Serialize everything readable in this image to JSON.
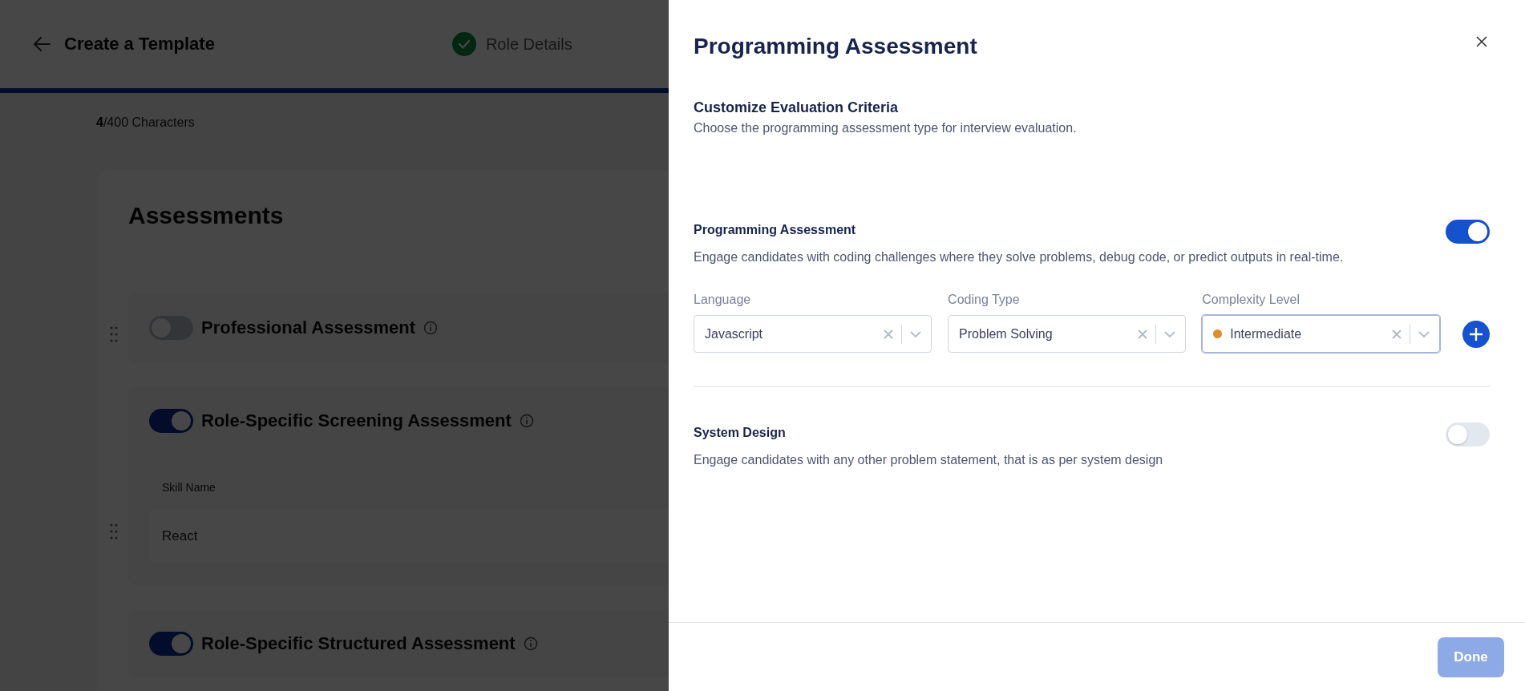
{
  "header": {
    "title": "Create a Template",
    "steps": [
      {
        "label": "Role Details",
        "completed": true
      }
    ]
  },
  "character_count": "**4**/400 Characters",
  "assessments": {
    "title": "Assessments",
    "items": [
      {
        "name": "Professional Assessment",
        "on": false,
        "draggable": true
      },
      {
        "name": "Role-Specific Screening Assessment",
        "on": true,
        "draggable": false,
        "field_draggable": true,
        "field_label": "Skill Name",
        "field_value": "React"
      },
      {
        "name": "Role-Specific Structured Assessment",
        "on": true,
        "draggable": false
      }
    ]
  },
  "drawer": {
    "title": "Programming Assessment",
    "section_title": "Customize Evaluation Criteria",
    "section_subtitle": "Choose the programming assessment type for interview evaluation.",
    "options": [
      {
        "title": "Programming Assessment",
        "description": "Engage candidates with coding challenges where they solve problems, debug code, or predict outputs in real-time.",
        "on": true,
        "fields": [
          {
            "label": "Language",
            "value": "Javascript",
            "focused": false
          },
          {
            "label": "Coding Type",
            "value": "Problem Solving",
            "focused": false
          },
          {
            "label": "Complexity Level",
            "value": "Intermediate",
            "focused": true,
            "color": "#e08e2b"
          }
        ]
      },
      {
        "title": "System Design",
        "description": "Engage candidates with any other problem statement, that is as per system design",
        "on": false
      }
    ],
    "done_button": {
      "label": "Done",
      "disabled": true
    }
  }
}
